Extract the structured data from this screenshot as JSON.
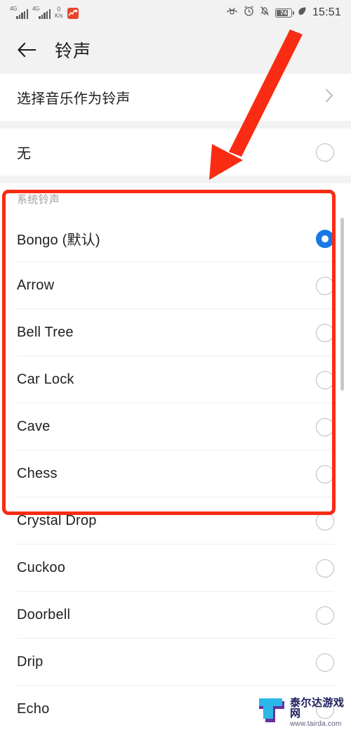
{
  "statusbar": {
    "signal1_label": "4G",
    "signal2_label": "4G",
    "net_speed_value": "0",
    "net_speed_unit": "K/s",
    "icons": [
      "eye-comfort-icon",
      "alarm-icon",
      "mute-icon",
      "battery-icon",
      "leaf-icon"
    ],
    "battery_level": "74",
    "time": "15:51"
  },
  "appbar": {
    "back_label": "back-arrow",
    "title": "铃声"
  },
  "pick_music": {
    "label": "选择音乐作为铃声",
    "chevron": "chevron-right-icon"
  },
  "none_row": {
    "label": "无",
    "selected": false
  },
  "section": {
    "header": "系统铃声"
  },
  "ringtones": [
    {
      "label": "Bongo (默认)",
      "selected": true
    },
    {
      "label": "Arrow",
      "selected": false
    },
    {
      "label": "Bell Tree",
      "selected": false
    },
    {
      "label": "Car Lock",
      "selected": false
    },
    {
      "label": "Cave",
      "selected": false
    },
    {
      "label": "Chess",
      "selected": false
    },
    {
      "label": "Crystal Drop",
      "selected": false
    },
    {
      "label": "Cuckoo",
      "selected": false
    },
    {
      "label": "Doorbell",
      "selected": false
    },
    {
      "label": "Drip",
      "selected": false
    },
    {
      "label": "Echo",
      "selected": false
    }
  ],
  "watermark": {
    "title": "泰尔达游戏网",
    "url": "www.tairda.com"
  },
  "colors": {
    "accent_blue": "#1878e6",
    "annotation_red": "#f92c13",
    "status_bg": "#f2f2f2",
    "card_bg": "#ffffff",
    "divider": "#ededed",
    "muted_text": "#a0a0a0"
  }
}
